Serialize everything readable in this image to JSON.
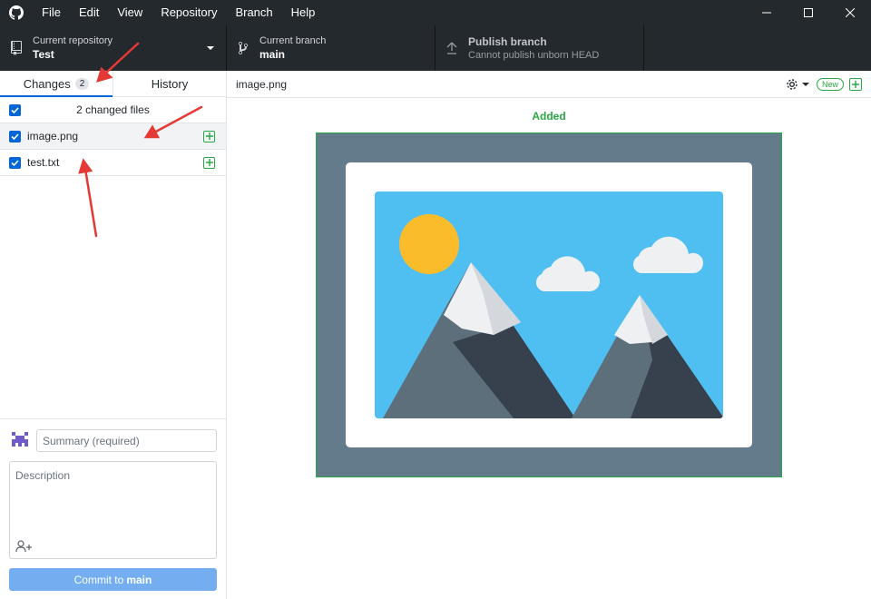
{
  "menu": [
    "File",
    "Edit",
    "View",
    "Repository",
    "Branch",
    "Help"
  ],
  "toolbar": {
    "repo_label": "Current repository",
    "repo_value": "Test",
    "branch_label": "Current branch",
    "branch_value": "main",
    "publish_label": "Publish branch",
    "publish_value": "Cannot publish unborn HEAD"
  },
  "sidebar": {
    "tabs": [
      {
        "label": "Changes",
        "count": "2"
      },
      {
        "label": "History"
      }
    ],
    "changed_files_label": "2 changed files",
    "files": [
      {
        "name": "image.png",
        "status": "added"
      },
      {
        "name": "test.txt",
        "status": "added"
      }
    ]
  },
  "commit": {
    "summary_placeholder": "Summary (required)",
    "description_placeholder": "Description",
    "button_prefix": "Commit to",
    "button_branch": "main"
  },
  "diff": {
    "file_path": "image.png",
    "status_label": "Added",
    "new_pill": "New"
  },
  "colors": {
    "accent": "#0366d6",
    "added": "#28a745",
    "annotation": "#e53935",
    "dark_bg": "#24292e"
  }
}
